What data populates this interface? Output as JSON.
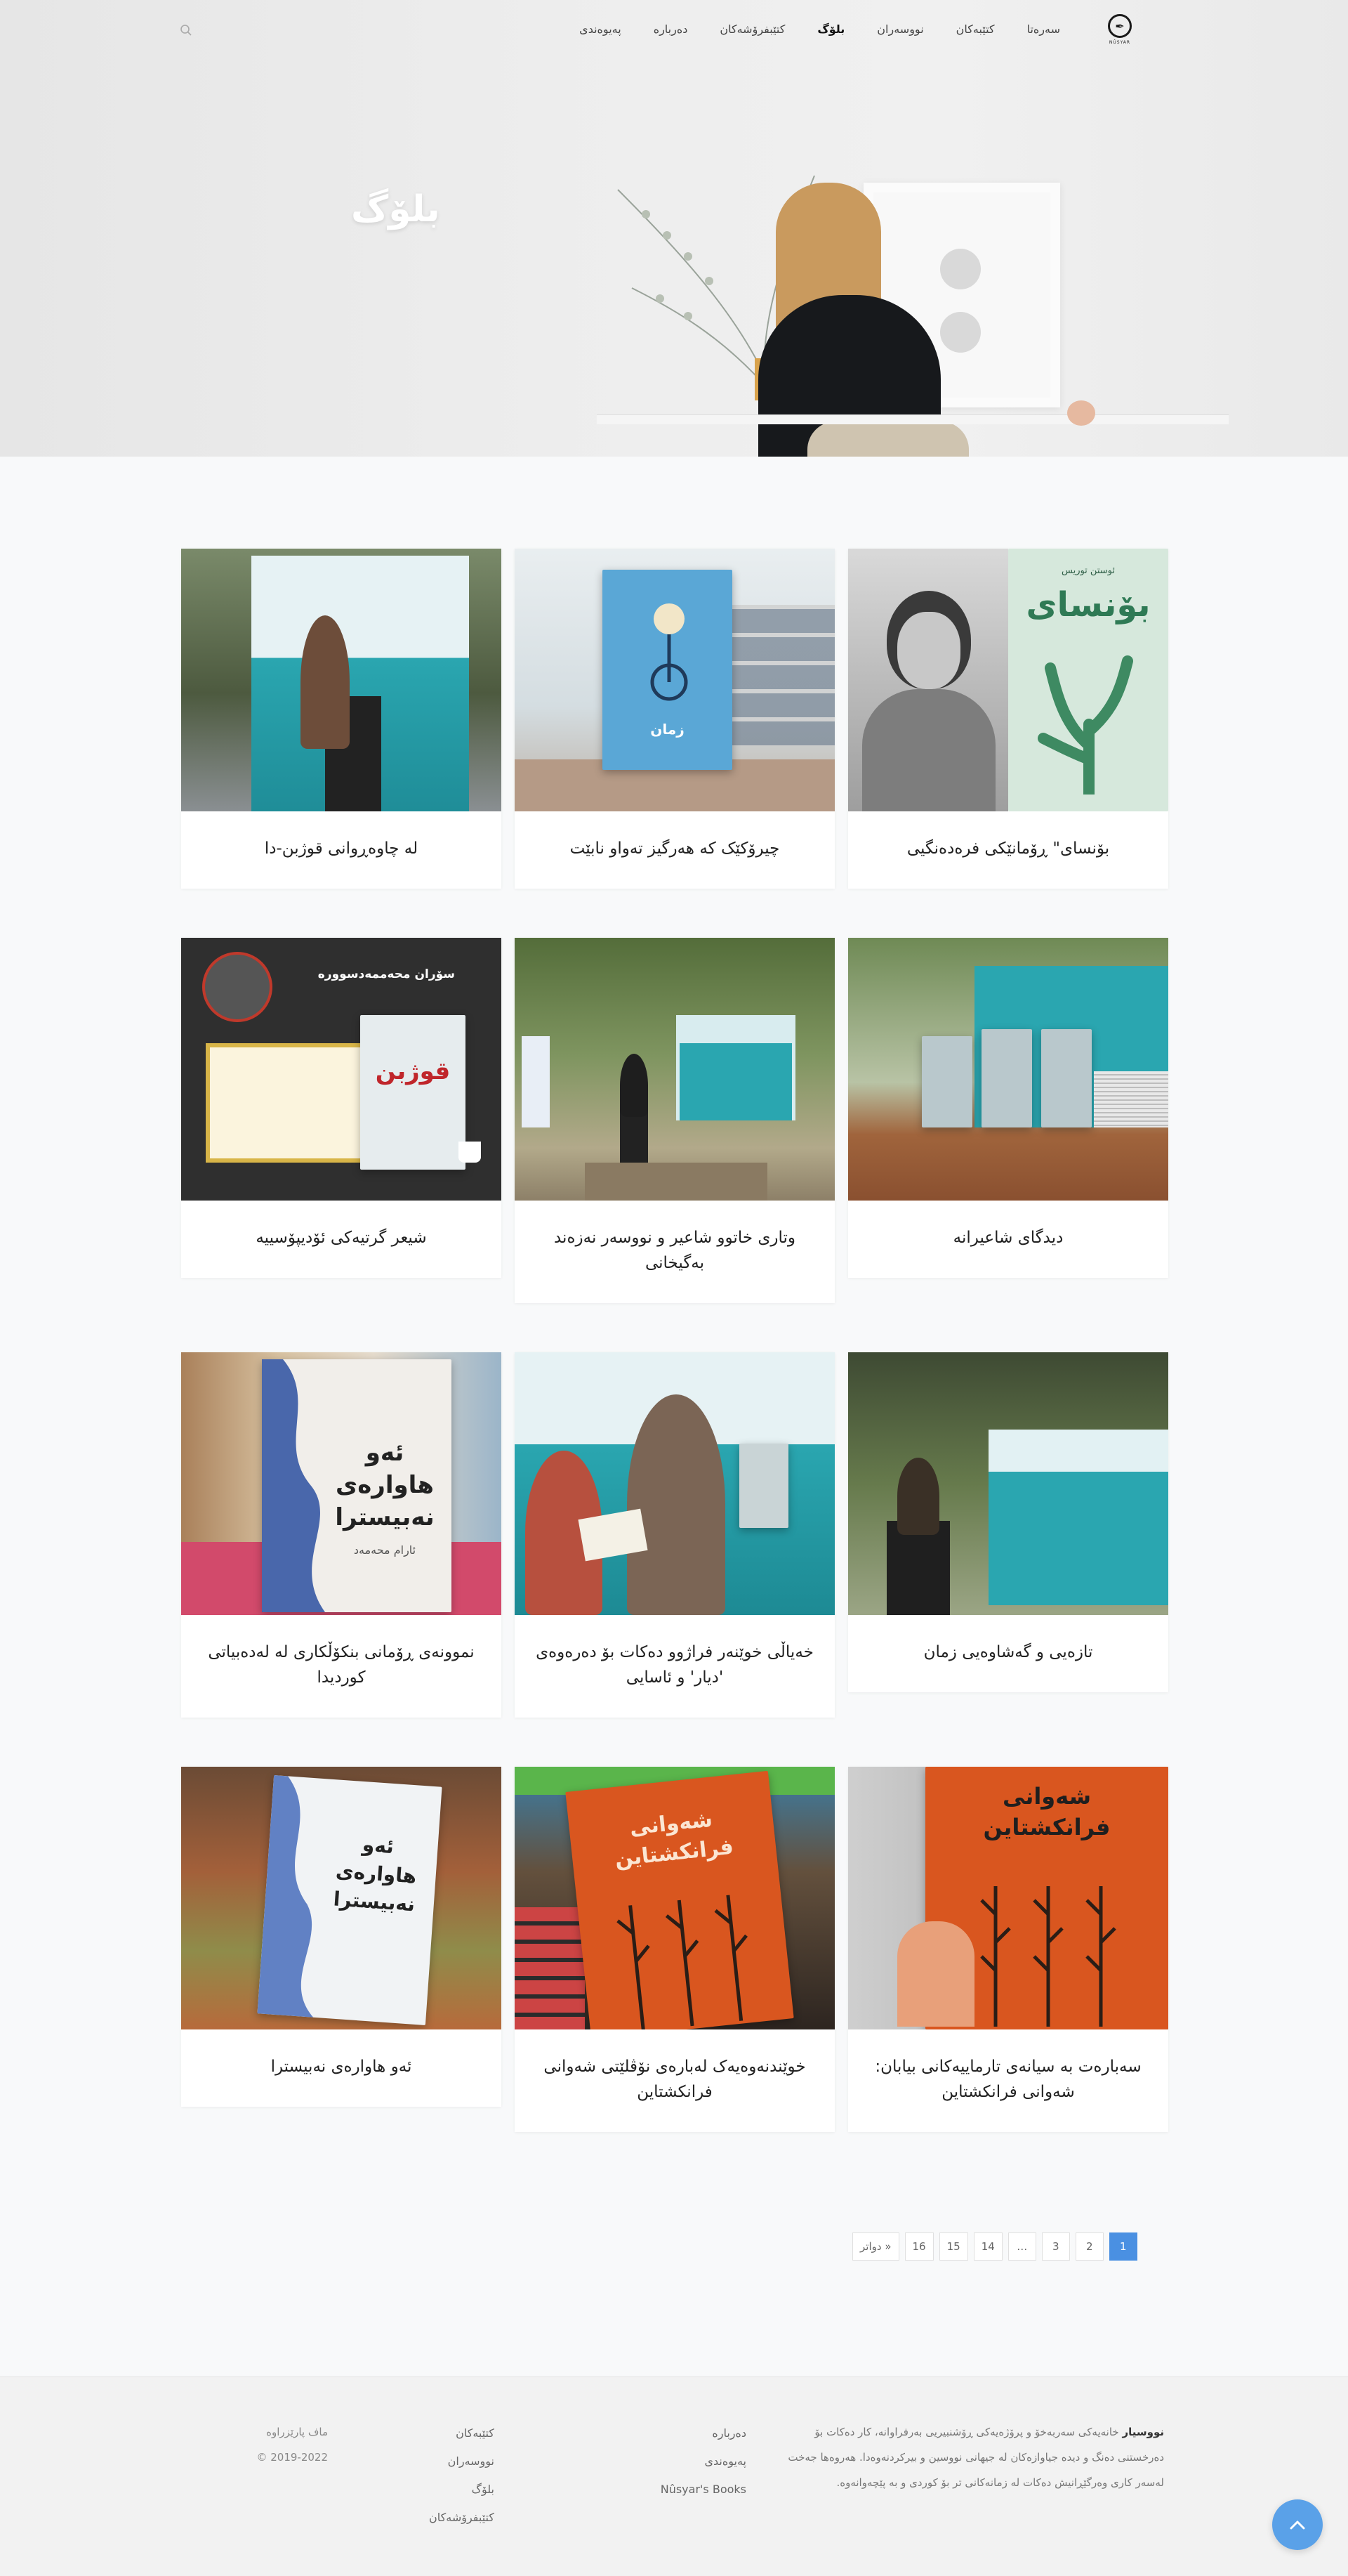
{
  "nav": {
    "items": [
      "سەرەتا",
      "کتێبەکان",
      "نووسەران",
      "بلۆگ",
      "کتێبفرۆشەکان",
      "دەربارە",
      "پەیوەندی"
    ],
    "active_index": 3,
    "logo_text": "NÛSYAR"
  },
  "hero": {
    "title": "بلۆگ"
  },
  "posts": [
    {
      "title": "بۆنسای\" ڕۆمانێکی فرەدەنگیی"
    },
    {
      "title": "چیرۆکێک کە هەرگیز تەواو نابێت"
    },
    {
      "title": "لە چاوەڕوانی قوژبن-دا"
    },
    {
      "title": "دیدگای شاعیرانە"
    },
    {
      "title": "وتاری خاتوو شاعیر و نووسەر نەزەند بەگیخانی"
    },
    {
      "title": "شیعر گرتیەکی ئۆدیپۆسییە"
    },
    {
      "title": "تازەیی و گەشاوەیی زمان"
    },
    {
      "title": "خەیاڵی خوێنەر فراژوو دەکات بۆ دەرەوەی 'دیار' و ئاسایی"
    },
    {
      "title": "نموونەی ڕۆمانی بنکۆڵکاری لە لەدەبیاتی کوردیدا"
    },
    {
      "title": "سەبارەت بە سیانەی تارماییەکانی بیابان: شەوانی فرانکشتاین"
    },
    {
      "title": "خوێندنەوەیەک لەبارەی نۆڤلێتی شەوانی فرانکشتاین"
    },
    {
      "title": "ئەو هاوارەی نەبیسترا"
    }
  ],
  "book_art": {
    "bonsai_title": "بۆنسای",
    "bonsai_author": "ئوستن توریس",
    "qozhin_title": "قوژبن",
    "zaman_title": "زمان",
    "aw_hawar_title": "ئەو هاوارەی نەبیسترا",
    "aw_hawar_author": "ئارام محەمەد",
    "frankenstein_title": "شەوانی فرانکشتاین",
    "soran_name": "سۆران محەممەدسوورە"
  },
  "pagination": {
    "pages": [
      "1",
      "2",
      "3",
      "…",
      "14",
      "15",
      "16",
      "دواتر »"
    ],
    "active_index": 0
  },
  "footer": {
    "brand": "نووسیار",
    "about": "خانەیەکی سەربەخۆ و پرۆژەیەکی ڕۆشنبیریی بەرفراوانە، کار دەکات بۆ دەرخستنی دەنگ و دیدە جیاوازەکان لە جیهانی نووسین و بیرکردنەوەدا. هەروەها جەخت لەسەر کاری وەرگێڕانیش دەکات لە زمانەکانی تر بۆ کوردی و بە پێچەوانەوە.",
    "col1": [
      "دەربارە",
      "پەیوەندی",
      "Nûsyar's Books"
    ],
    "col2": [
      "کتێبەکان",
      "نووسەران",
      "بلۆگ",
      "کتێبفرۆشەکان"
    ],
    "rights": "ماف پارێزراوە",
    "copyright": "© 2019-2022"
  },
  "colors": {
    "accent": "#4a90e2",
    "to_top": "#5aa1e8"
  }
}
